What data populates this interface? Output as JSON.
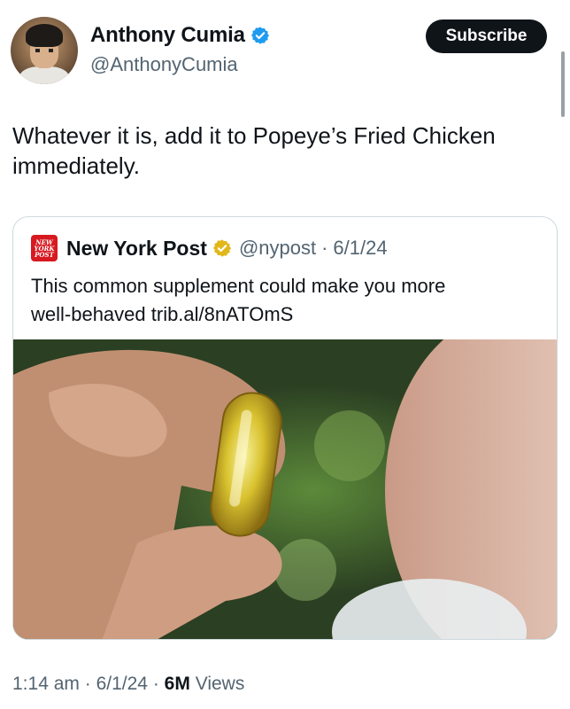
{
  "author": {
    "display_name": "Anthony Cumia",
    "handle": "@AnthonyCumia"
  },
  "subscribe_label": "Subscribe",
  "tweet": {
    "text_line1": "Whatever it is, add it to Popeye’s Fried Chicken",
    "text_line2": "immediately."
  },
  "quote": {
    "logo_lines": [
      "NEW",
      "YORK",
      "POST"
    ],
    "name": "New York Post",
    "handle": "@nypost",
    "separator": "·",
    "date": "6/1/24",
    "text_line1": "This common supplement could make you more",
    "text_line2": "well-behaved trib.al/8nATOmS"
  },
  "meta": {
    "time": "1:14 am",
    "sep1": "·",
    "date": "6/1/24",
    "sep2": "·",
    "views_count": "6M",
    "views_label": "Views"
  },
  "icons": {
    "verified": "verified-badge-icon",
    "gold_verified": "gold-verified-badge-icon"
  },
  "colors": {
    "blue_check": "#1d9bf0",
    "gold_check": "#e2b719",
    "nyp_red": "#d71920",
    "subscribe_bg": "#0f1419",
    "secondary_text": "#536471"
  }
}
